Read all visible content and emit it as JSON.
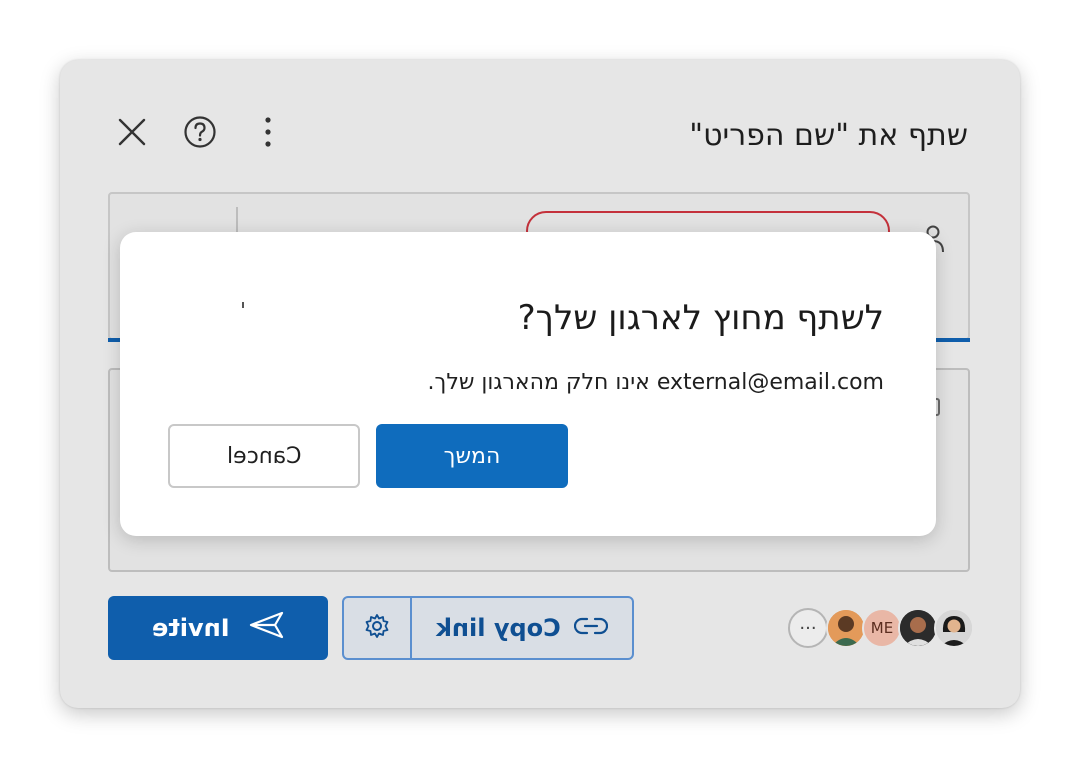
{
  "share_panel": {
    "title": "שתף את \"שם הפריט\"",
    "header_icons": [
      "close-icon",
      "help-icon",
      "more-options-icon"
    ],
    "invite_label": "Invite",
    "copy_link_label": "Copy link",
    "avatars": [
      {
        "name": "avatar-1",
        "initials": ""
      },
      {
        "name": "avatar-2",
        "initials": ""
      },
      {
        "name": "avatar-3",
        "initials": "ME"
      },
      {
        "name": "avatar-4",
        "initials": ""
      }
    ],
    "more_avatars_label": "···"
  },
  "dialog": {
    "title": "לשתף מחוץ לארגון שלך?",
    "body": "external@email.com אינו חלק מהארגון שלך.",
    "continue_label": "המשך",
    "cancel_label": "Cancel"
  },
  "colors": {
    "accent": "#0f6cbd",
    "chip_border": "#c4313b",
    "panel_bg": "#e6e6e6"
  }
}
